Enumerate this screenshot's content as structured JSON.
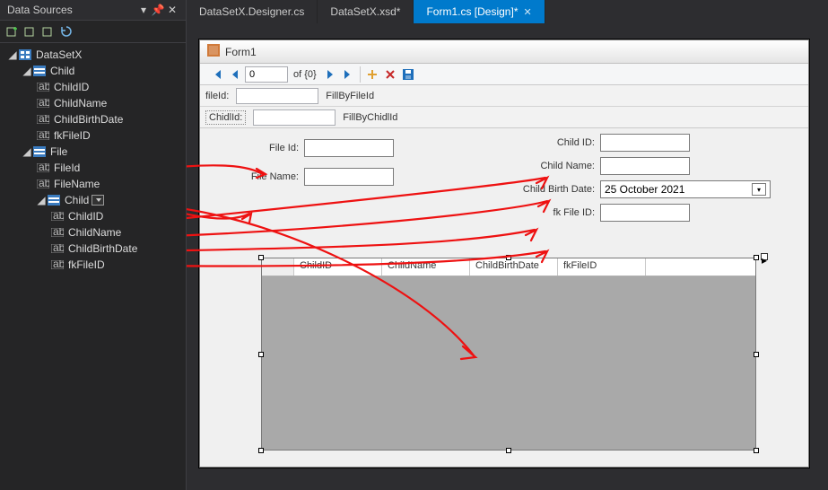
{
  "panel": {
    "title": "Data Sources",
    "tree": {
      "root": "DataSetX",
      "child_table": "Child",
      "child_cols": [
        "ChildID",
        "ChildName",
        "ChildBirthDate",
        "fkFileID"
      ],
      "file_table": "File",
      "file_cols": [
        "FileId",
        "FileName"
      ],
      "file_child": "Child",
      "file_child_cols": [
        "ChildID",
        "ChildName",
        "ChildBirthDate",
        "fkFileID"
      ]
    }
  },
  "tabs": {
    "t1": "DataSetX.Designer.cs",
    "t2": "DataSetX.xsd*",
    "t3": "Form1.cs [Design]*"
  },
  "form": {
    "title": "Form1",
    "nav": {
      "pos": "0",
      "of": "of {0}"
    },
    "fill1": {
      "label": "fileId:",
      "btn": "FillByFileId"
    },
    "fill2": {
      "label": "ChidlId:",
      "btn": "FillByChidlId"
    },
    "left_labels": {
      "fileid": "File Id:",
      "filename": "File Name:"
    },
    "right_labels": {
      "childid": "Child ID:",
      "childname": "Child Name:",
      "birth": "Child Birth Date:",
      "fk": "fk File ID:"
    },
    "dtp_value": "25  October   2021",
    "grid_cols": [
      "ChildID",
      "ChildName",
      "ChildBirthDate",
      "fkFileID"
    ]
  }
}
